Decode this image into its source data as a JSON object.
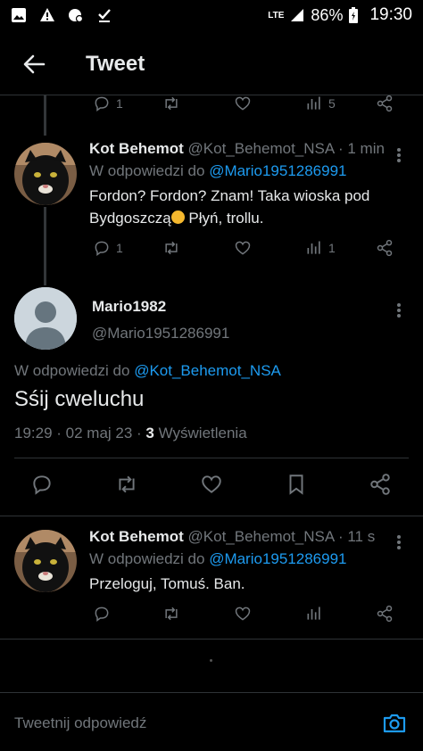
{
  "status_bar": {
    "network": "LTE",
    "battery": "86%",
    "time": "19:30"
  },
  "header": {
    "title": "Tweet"
  },
  "top_tweet_actions": {
    "reply_count": "1",
    "views_count": "5"
  },
  "reply1": {
    "name": "Kot Behemot",
    "handle": "@Kot_Behemot_NSA · 1 min",
    "reply_prefix": "W odpowiedzi do ",
    "reply_target": "@Mario1951286991",
    "text_line1": "Fordon? Fordon? Znam! Taka wioska pod",
    "text_line2_a": "Bydgoszczą",
    "text_line2_b": " Płyń, trollu.",
    "reply_count": "1",
    "views_count": "1"
  },
  "main_tweet": {
    "name": "Mario1982",
    "handle": "@Mario1951286991",
    "reply_prefix": "W odpowiedzi do ",
    "reply_target": "@Kot_Behemot_NSA",
    "text": "Sśij cweluchu",
    "meta_time": "19:29 · 02 maj 23 · ",
    "views_number": "3",
    "views_label": " Wyświetlenia"
  },
  "reply2": {
    "name": "Kot Behemot",
    "handle": "@Kot_Behemot_NSA · 11 s",
    "reply_prefix": "W odpowiedzi do ",
    "reply_target": "@Mario1951286991",
    "text": "Przeloguj, Tomuś. Ban."
  },
  "compose": {
    "placeholder": "Tweetnij odpowiedź"
  },
  "colors": {
    "background": "#000000",
    "accent": "#1d9bf0",
    "muted": "#71767b",
    "text": "#e7e9ea"
  }
}
